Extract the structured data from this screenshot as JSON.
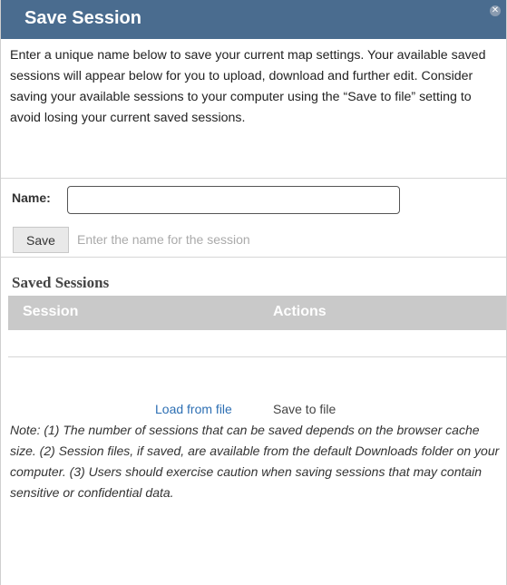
{
  "dialog": {
    "title": "Save Session",
    "close_glyph": "✕",
    "intro": "Enter a unique name below to save your current map settings. Your available saved sessions will appear below for you to upload, download and further edit. Consider saving your available sessions to your computer using the “Save to file” setting to avoid losing your current saved sessions."
  },
  "form": {
    "name_label": "Name:",
    "name_value": "",
    "save_label": "Save",
    "hint": "Enter the name for the session"
  },
  "saved": {
    "heading": "Saved Sessions",
    "columns": [
      "Session",
      "Actions"
    ]
  },
  "file_actions": {
    "load_label": "Load from file",
    "save_label": "Save to file"
  },
  "note": "Note: (1) The number of sessions that can be saved depends on the browser cache size. (2) Session files, if saved, are available from the default Downloads folder on your computer. (3) Users should exercise caution when saving sessions that may contain sensitive or confidential data.",
  "colors": {
    "titlebar": "#4a6c8f",
    "table_header": "#c9c9c9",
    "link": "#2d6fb3"
  },
  "icons": {
    "close": "close-icon"
  }
}
